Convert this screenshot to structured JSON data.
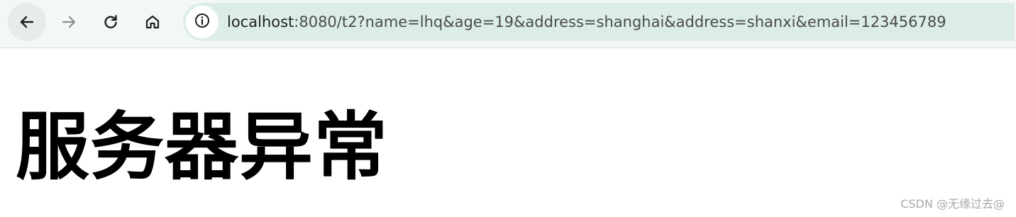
{
  "browser": {
    "nav": {
      "back_icon": "arrow-left-icon",
      "forward_icon": "arrow-right-icon",
      "reload_icon": "reload-icon",
      "home_icon": "home-icon"
    },
    "address_bar": {
      "info_icon": "info-icon",
      "url_host": "localhost",
      "url_rest": ":8080/t2?name=lhq&age=19&address=shanghai&address=shanxi&email=123456789"
    },
    "colors": {
      "toolbar_bg": "#f3f8f6",
      "omnibox_bg": "#dcede7",
      "icon_color": "#1f1f1f",
      "icon_disabled": "#8a8f8d"
    }
  },
  "page": {
    "heading": "服务器异常"
  },
  "watermark": {
    "text": "CSDN @无缘过去@"
  }
}
